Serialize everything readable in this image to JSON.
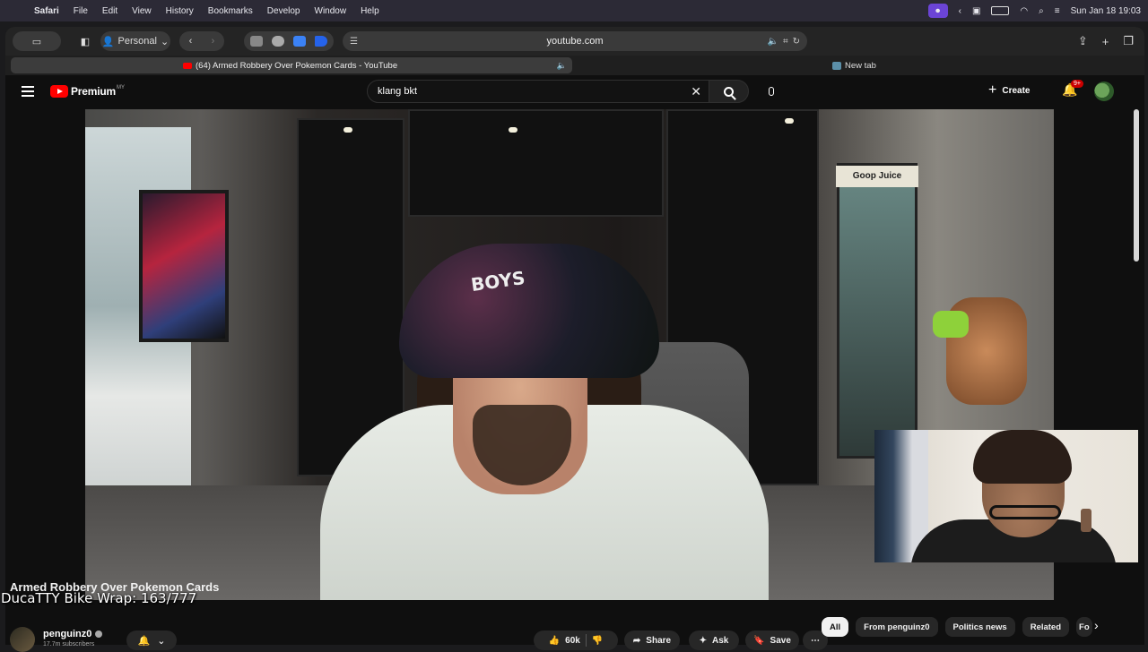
{
  "menubar": {
    "app": "Safari",
    "items": [
      "File",
      "Edit",
      "View",
      "History",
      "Bookmarks",
      "Develop",
      "Window",
      "Help"
    ],
    "clock": "Sun Jan 18  19:03"
  },
  "browser": {
    "profile": "Personal",
    "url": "youtube.com",
    "tabs": [
      {
        "title": "(64) Armed Robbery Over Pokemon Cards - YouTube",
        "active": true
      },
      {
        "title": "New tab",
        "active": false
      }
    ]
  },
  "youtube": {
    "logo_text": "Premium",
    "region": "MY",
    "search_value": "klang bkt",
    "create_label": "Create",
    "notifications_badge": "9+"
  },
  "video": {
    "hat_text": "BOYS",
    "fridge_brand": "Goop Juice",
    "overlay_counter": "DucaTTY Bike Wrap: 163/777"
  },
  "below_video": {
    "title": "Armed Robbery Over Pokemon Cards",
    "channel": "penguinz0",
    "subscribers": "17.7m subscribers",
    "likes": "60k",
    "share": "Share",
    "ask": "Ask",
    "save": "Save",
    "chips": [
      "All",
      "From penguinz0",
      "Politics news",
      "Related",
      "Fo"
    ]
  },
  "colors": {
    "accent": "#ff0000",
    "badge": "#cc0000",
    "background": "#0f0f0f"
  }
}
